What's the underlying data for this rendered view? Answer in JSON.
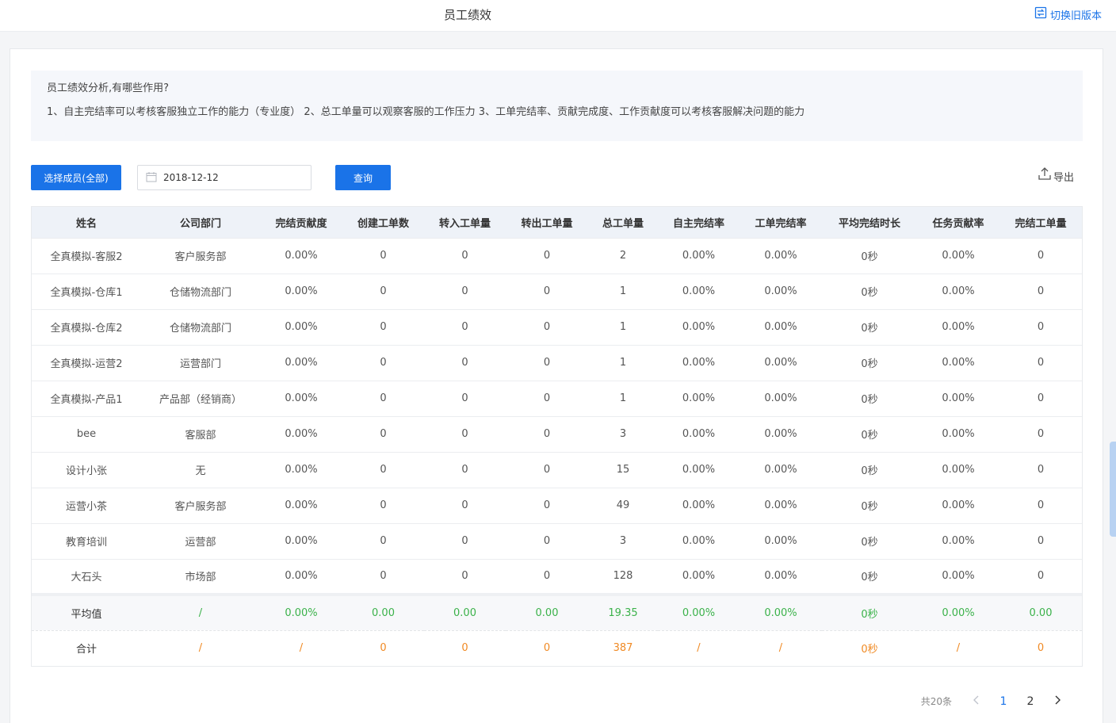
{
  "header": {
    "title": "员工绩效",
    "switch_label": "切换旧版本"
  },
  "info": {
    "title": "员工绩效分析,有哪些作用?",
    "text": "1、自主完结率可以考核客服独立工作的能力（专业度） 2、总工单量可以观察客服的工作压力 3、工单完结率、贡献完成度、工作贡献度可以考核客服解决问题的能力"
  },
  "toolbar": {
    "member_button": "选择成员(全部)",
    "date_value": "2018-12-12",
    "query_button": "查询",
    "export_label": "导出"
  },
  "table": {
    "columns": [
      "姓名",
      "公司部门",
      "完结贡献度",
      "创建工单数",
      "转入工单量",
      "转出工单量",
      "总工单量",
      "自主完结率",
      "工单完结率",
      "平均完结时长",
      "任务贡献率",
      "完结工单量"
    ],
    "rows": [
      [
        "全真模拟-客服2",
        "客户服务部",
        "0.00%",
        "0",
        "0",
        "0",
        "2",
        "0.00%",
        "0.00%",
        "0秒",
        "0.00%",
        "0"
      ],
      [
        "全真模拟-仓库1",
        "仓储物流部门",
        "0.00%",
        "0",
        "0",
        "0",
        "1",
        "0.00%",
        "0.00%",
        "0秒",
        "0.00%",
        "0"
      ],
      [
        "全真模拟-仓库2",
        "仓储物流部门",
        "0.00%",
        "0",
        "0",
        "0",
        "1",
        "0.00%",
        "0.00%",
        "0秒",
        "0.00%",
        "0"
      ],
      [
        "全真模拟-运营2",
        "运营部门",
        "0.00%",
        "0",
        "0",
        "0",
        "1",
        "0.00%",
        "0.00%",
        "0秒",
        "0.00%",
        "0"
      ],
      [
        "全真模拟-产品1",
        "产品部（经销商）",
        "0.00%",
        "0",
        "0",
        "0",
        "1",
        "0.00%",
        "0.00%",
        "0秒",
        "0.00%",
        "0"
      ],
      [
        "bee",
        "客服部",
        "0.00%",
        "0",
        "0",
        "0",
        "3",
        "0.00%",
        "0.00%",
        "0秒",
        "0.00%",
        "0"
      ],
      [
        "设计小张",
        "无",
        "0.00%",
        "0",
        "0",
        "0",
        "15",
        "0.00%",
        "0.00%",
        "0秒",
        "0.00%",
        "0"
      ],
      [
        "运营小茶",
        "客户服务部",
        "0.00%",
        "0",
        "0",
        "0",
        "49",
        "0.00%",
        "0.00%",
        "0秒",
        "0.00%",
        "0"
      ],
      [
        "教育培训",
        "运营部",
        "0.00%",
        "0",
        "0",
        "0",
        "3",
        "0.00%",
        "0.00%",
        "0秒",
        "0.00%",
        "0"
      ],
      [
        "大石头",
        "市场部",
        "0.00%",
        "0",
        "0",
        "0",
        "128",
        "0.00%",
        "0.00%",
        "0秒",
        "0.00%",
        "0"
      ]
    ],
    "average": [
      "平均值",
      "/",
      "0.00%",
      "0.00",
      "0.00",
      "0.00",
      "19.35",
      "0.00%",
      "0.00%",
      "0秒",
      "0.00%",
      "0.00"
    ],
    "total": [
      "合计",
      "/",
      "/",
      "0",
      "0",
      "0",
      "387",
      "/",
      "/",
      "0秒",
      "/",
      "0"
    ]
  },
  "pagination": {
    "total_label": "共20条",
    "pages": [
      "1",
      "2"
    ],
    "current": "1"
  },
  "colors": {
    "accent": "#1a73e8",
    "average": "#3bb24a",
    "total": "#f08a24"
  }
}
